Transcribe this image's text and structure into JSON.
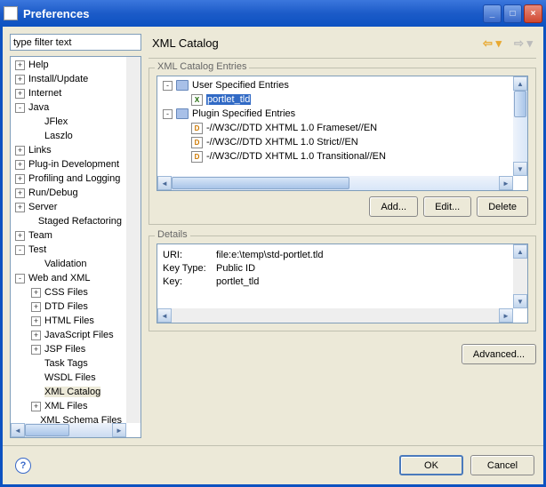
{
  "window": {
    "title": "Preferences"
  },
  "filter": {
    "placeholder": "type filter text"
  },
  "tree": [
    {
      "label": "Help",
      "depth": 1,
      "exp": "+"
    },
    {
      "label": "Install/Update",
      "depth": 1,
      "exp": "+"
    },
    {
      "label": "Internet",
      "depth": 1,
      "exp": "+"
    },
    {
      "label": "Java",
      "depth": 1,
      "exp": "-"
    },
    {
      "label": "JFlex",
      "depth": 2,
      "exp": ""
    },
    {
      "label": "Laszlo",
      "depth": 2,
      "exp": ""
    },
    {
      "label": "Links",
      "depth": 1,
      "exp": "+"
    },
    {
      "label": "Plug-in Development",
      "depth": 1,
      "exp": "+"
    },
    {
      "label": "Profiling and Logging",
      "depth": 1,
      "exp": "+"
    },
    {
      "label": "Run/Debug",
      "depth": 1,
      "exp": "+"
    },
    {
      "label": "Server",
      "depth": 1,
      "exp": "+"
    },
    {
      "label": "Staged Refactoring",
      "depth": 2,
      "exp": ""
    },
    {
      "label": "Team",
      "depth": 1,
      "exp": "+"
    },
    {
      "label": "Test",
      "depth": 1,
      "exp": "-"
    },
    {
      "label": "Validation",
      "depth": 2,
      "exp": ""
    },
    {
      "label": "Web and XML",
      "depth": 1,
      "exp": "-"
    },
    {
      "label": "CSS Files",
      "depth": 2,
      "exp": "+"
    },
    {
      "label": "DTD Files",
      "depth": 2,
      "exp": "+"
    },
    {
      "label": "HTML Files",
      "depth": 2,
      "exp": "+"
    },
    {
      "label": "JavaScript Files",
      "depth": 2,
      "exp": "+"
    },
    {
      "label": "JSP Files",
      "depth": 2,
      "exp": "+"
    },
    {
      "label": "Task Tags",
      "depth": 2,
      "exp": ""
    },
    {
      "label": "WSDL Files",
      "depth": 2,
      "exp": ""
    },
    {
      "label": "XML Catalog",
      "depth": 2,
      "exp": "",
      "selected": true
    },
    {
      "label": "XML Files",
      "depth": 2,
      "exp": "+"
    },
    {
      "label": "XML Schema Files",
      "depth": 2,
      "exp": ""
    }
  ],
  "page": {
    "title": "XML Catalog"
  },
  "entries_group": {
    "label": "XML Catalog Entries",
    "rows": [
      {
        "depth": 1,
        "exp": "-",
        "icon": "folder",
        "label": "User Specified Entries"
      },
      {
        "depth": 2,
        "exp": "",
        "icon": "X",
        "label": "portlet_tld",
        "selected": true
      },
      {
        "depth": 1,
        "exp": "-",
        "icon": "folder",
        "label": "Plugin Specified Entries"
      },
      {
        "depth": 2,
        "exp": "",
        "icon": "D",
        "label": "-//W3C//DTD XHTML 1.0 Frameset//EN"
      },
      {
        "depth": 2,
        "exp": "",
        "icon": "D",
        "label": "-//W3C//DTD XHTML 1.0 Strict//EN"
      },
      {
        "depth": 2,
        "exp": "",
        "icon": "D",
        "label": "-//W3C//DTD XHTML 1.0 Transitional//EN"
      }
    ],
    "buttons": {
      "add": "Add...",
      "edit": "Edit...",
      "delete": "Delete"
    }
  },
  "details_group": {
    "label": "Details",
    "uri_k": "URI:",
    "uri_v": "file:e:\\temp\\std-portlet.tld",
    "keytype_k": "Key Type:",
    "keytype_v": "Public ID",
    "key_k": "Key:",
    "key_v": "portlet_tld"
  },
  "advanced": "Advanced...",
  "footer": {
    "ok": "OK",
    "cancel": "Cancel"
  }
}
